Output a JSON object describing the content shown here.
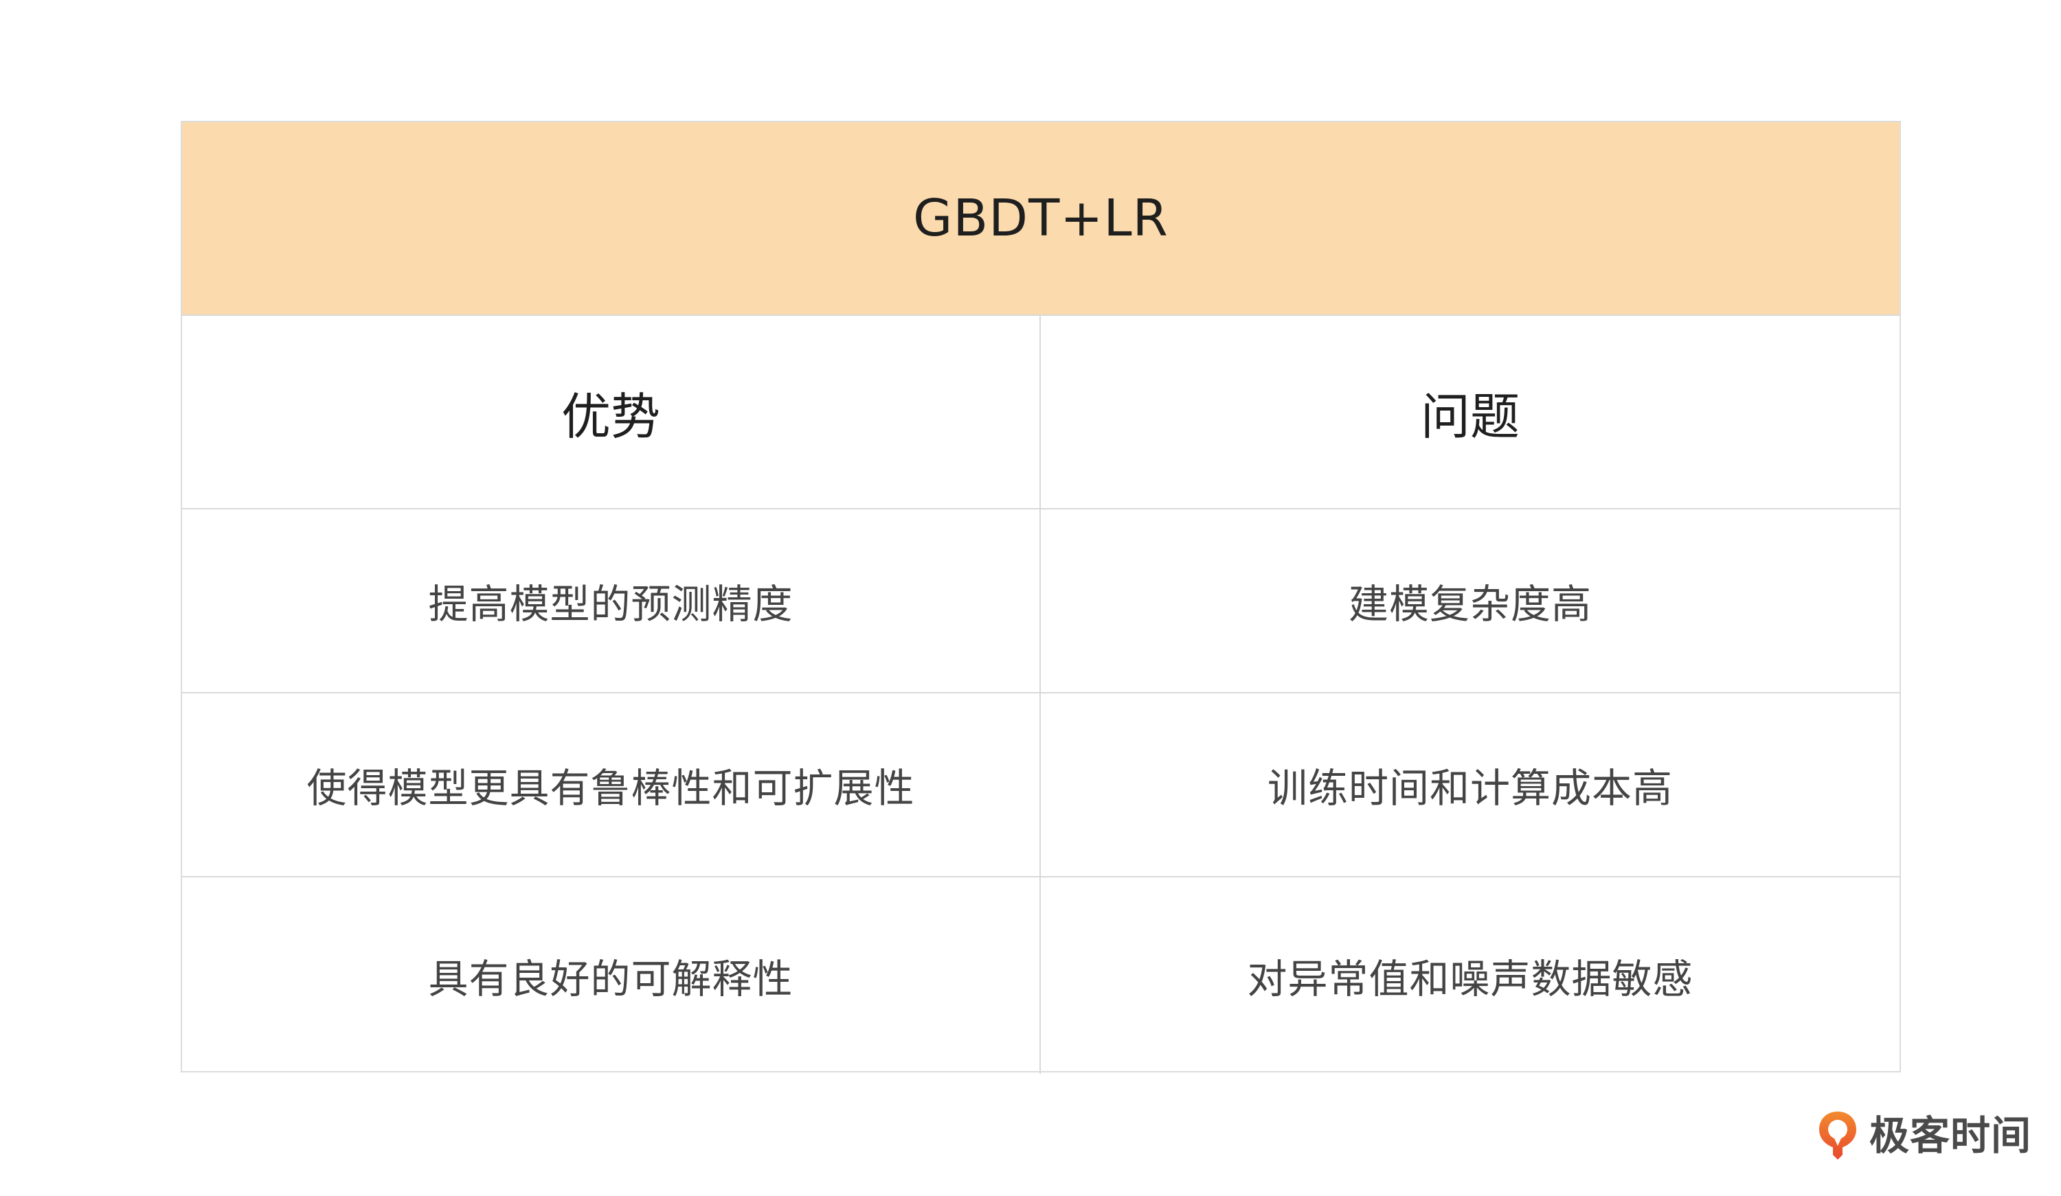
{
  "table": {
    "title": "GBDT+LR",
    "headers": [
      "优势",
      "问题"
    ],
    "rows": [
      [
        "提高模型的预测精度",
        "建模复杂度高"
      ],
      [
        "使得模型更具有鲁棒性和可扩展性",
        "训练时间和计算成本高"
      ],
      [
        "具有良好的可解释性",
        "对异常值和噪声数据敏感"
      ]
    ]
  },
  "branding": {
    "name": "极客时间",
    "logo_icon": "geek-time-logo-icon"
  },
  "colors": {
    "title_background": "#fbdbad",
    "logo_orange": "#ef6c2f",
    "border": "#d8d8d8"
  }
}
